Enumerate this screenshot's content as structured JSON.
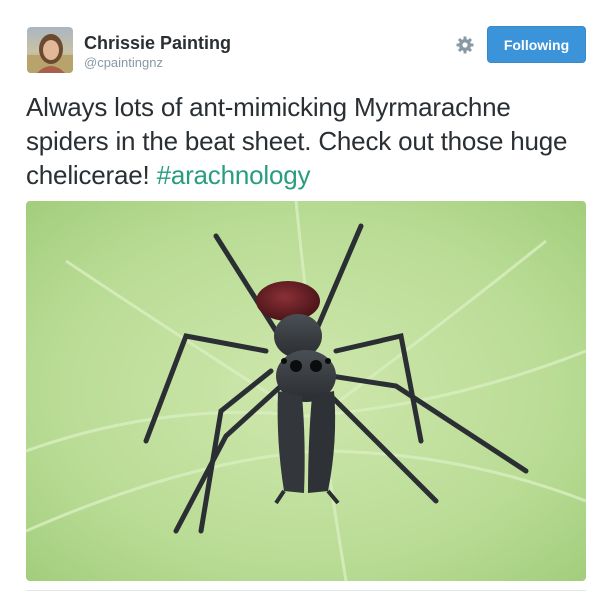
{
  "user": {
    "name": "Chrissie Painting",
    "handle": "@cpaintingnz"
  },
  "actions": {
    "follow_label": "Following",
    "settings_icon": "gear-icon"
  },
  "tweet": {
    "text": "Always lots of ant-mimicking Myrmarachne spiders in the beat sheet. Check out those huge chelicerae! ",
    "hashtag": "#arachnology"
  },
  "colors": {
    "follow_button": "#3b94d9",
    "hashtag": "#2a9d7e",
    "name": "#292f33",
    "handle": "#8899a6"
  },
  "media": {
    "description_icon": "photo-spider-on-leaf"
  }
}
